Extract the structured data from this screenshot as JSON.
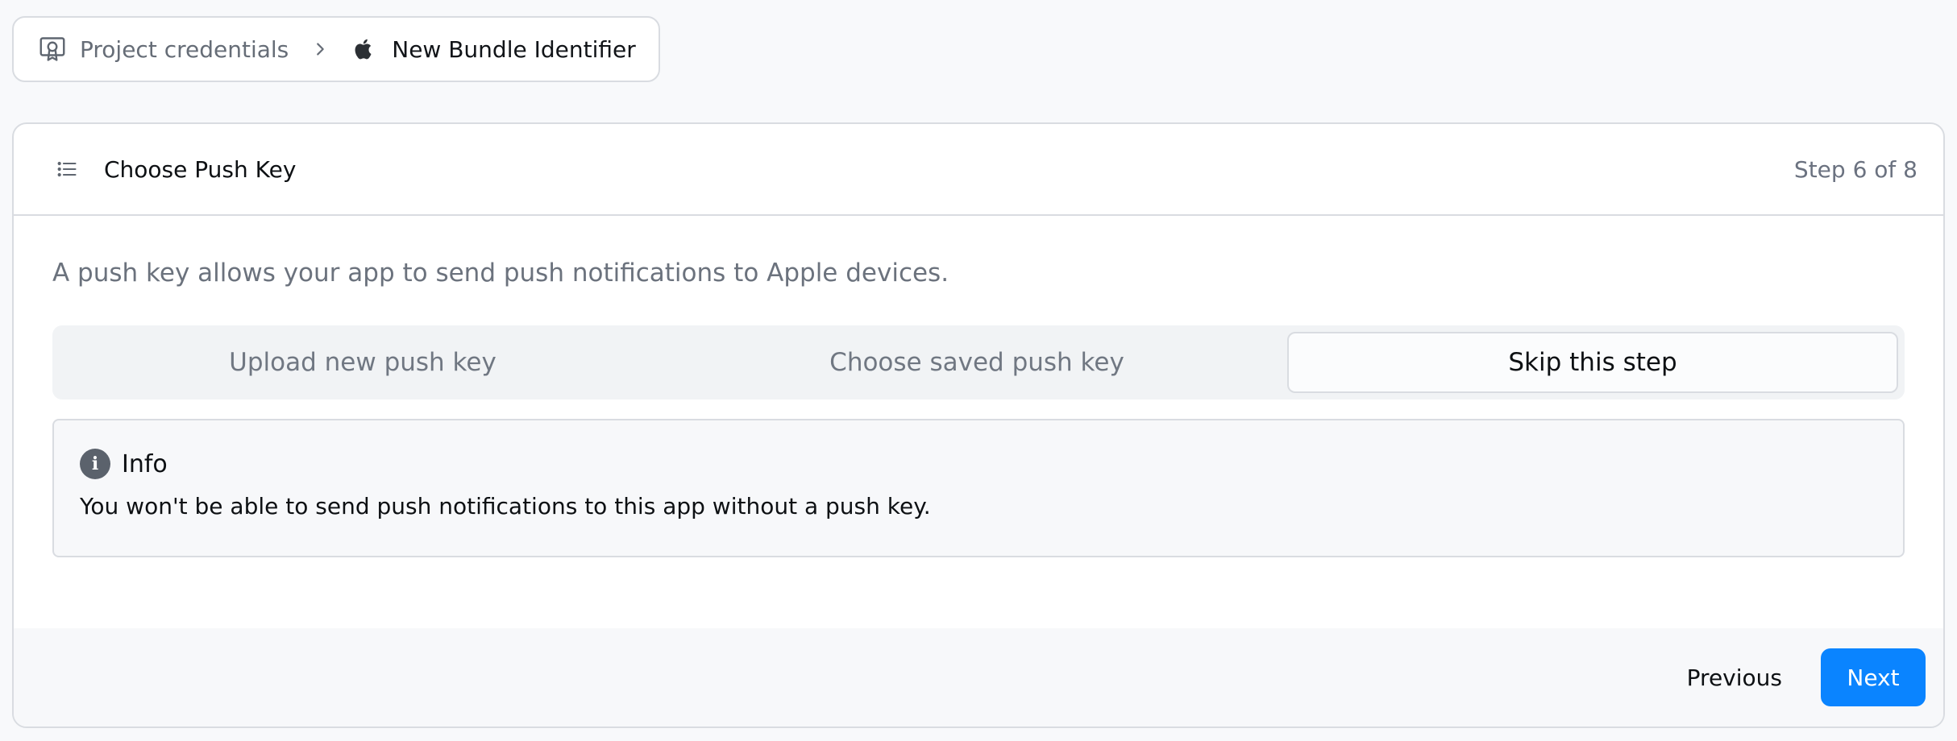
{
  "breadcrumb": {
    "project_icon": "certificate-icon",
    "project_label": "Project credentials",
    "separator_icon": "chevron-right-icon",
    "current_icon": "apple-icon",
    "current_label": "New Bundle Identifier"
  },
  "card": {
    "header_icon": "list-icon",
    "title": "Choose Push Key",
    "step": "Step 6 of 8"
  },
  "body": {
    "description": "A push key allows your app to send push notifications to Apple devices.",
    "options": [
      {
        "label": "Upload new push key",
        "selected": false
      },
      {
        "label": "Choose saved push key",
        "selected": false
      },
      {
        "label": "Skip this step",
        "selected": true
      }
    ]
  },
  "info": {
    "icon": "info-icon",
    "title": "Info",
    "text": "You won't be able to send push notifications to this app without a push key."
  },
  "footer": {
    "previous_label": "Previous",
    "next_label": "Next"
  },
  "colors": {
    "accent": "#0a84ff",
    "page_background": "#f8f9fb",
    "border": "#d9dce1"
  }
}
